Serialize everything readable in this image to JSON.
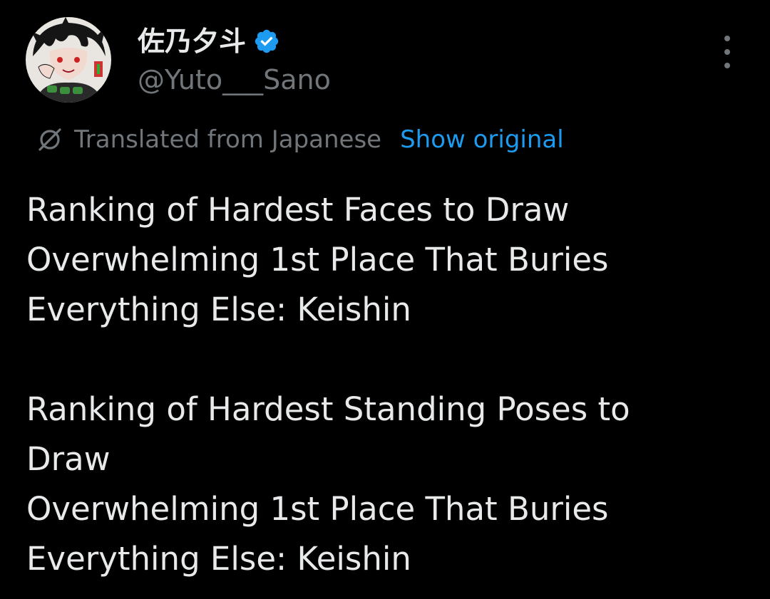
{
  "author": {
    "display_name": "佐乃夕斗",
    "handle": "@Yuto___Sano",
    "verified_icon": "verified-badge-icon",
    "avatar_icon": "avatar"
  },
  "header": {
    "more_icon": "more-vertical-icon"
  },
  "translation": {
    "icon": "translate-icon",
    "label": "Translated from Japanese",
    "show_original": "Show original"
  },
  "tweet": {
    "paragraphs": [
      {
        "lines": [
          "Ranking of Hardest Faces to Draw",
          "Overwhelming 1st Place That Buries",
          "Everything Else: Keishin"
        ]
      },
      {
        "lines": [
          "Ranking of Hardest Standing Poses to",
          "Draw",
          "Overwhelming 1st Place That Buries",
          "Everything Else: Keishin"
        ]
      }
    ]
  },
  "colors": {
    "background": "#000000",
    "text_primary": "#e7e9ea",
    "text_secondary": "#71767b",
    "accent": "#1d9bf0"
  }
}
